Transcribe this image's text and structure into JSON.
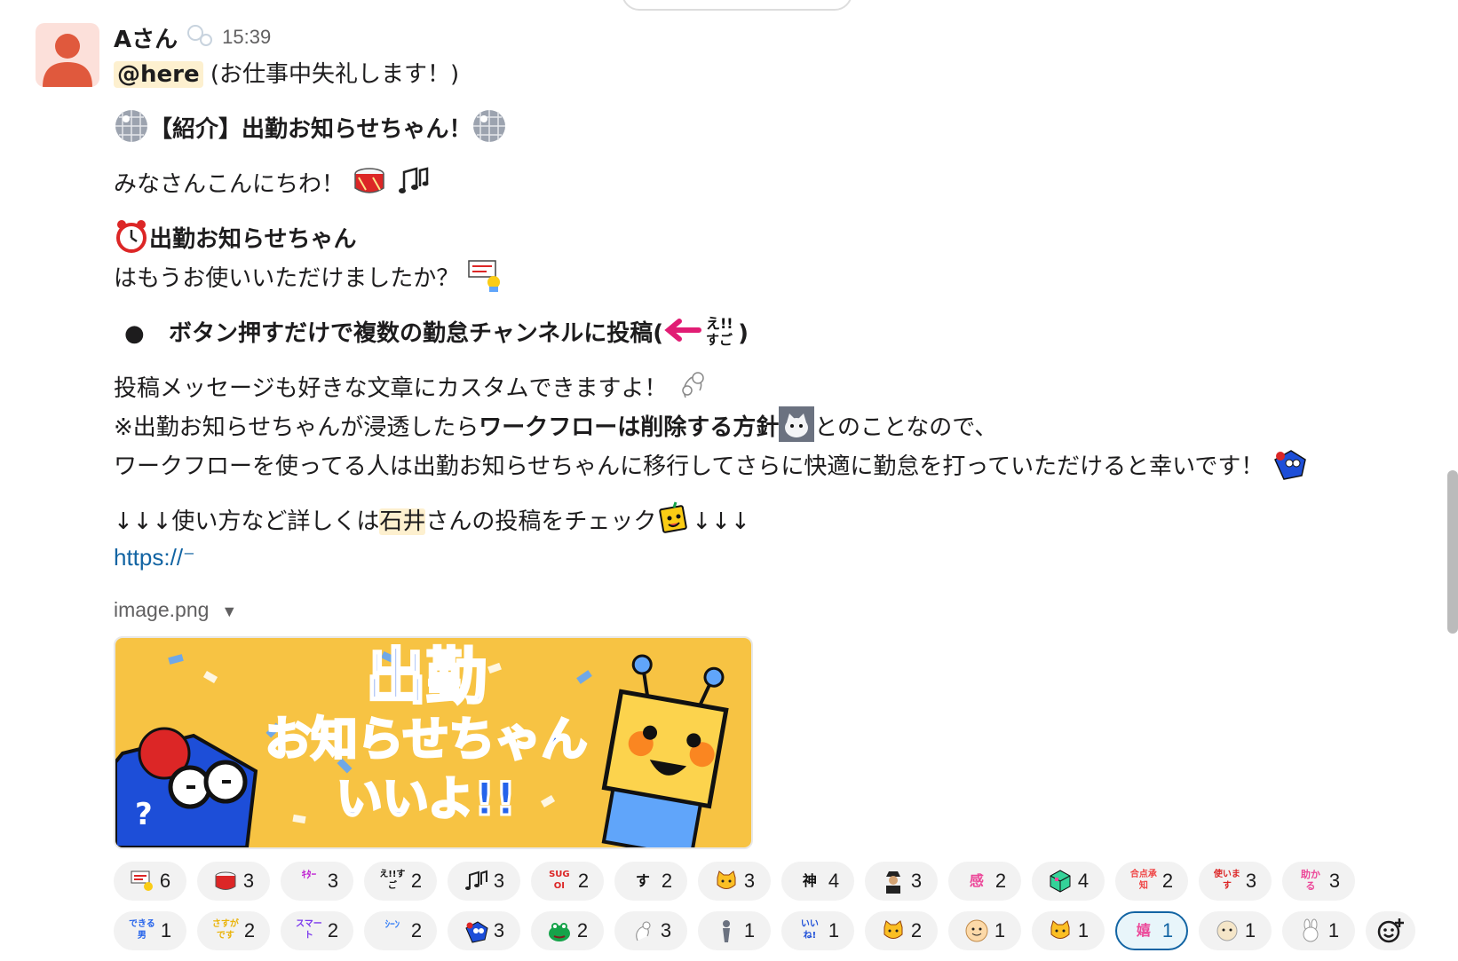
{
  "message": {
    "sender": "Aさん",
    "time": "15:39",
    "mention": "@here",
    "greeting_rest": " (お仕事中失礼します！)",
    "title": "【紹介】出勤お知らせちゃん！",
    "hello": "みなさんこんにちわ！",
    "app_name": "出勤お知らせちゃん",
    "question": "はもうお使いいただけましたか？",
    "bullet": "ボタン押すだけで複数の勤怠チャンネルに投稿(",
    "bullet_close": ")",
    "custom_line": "投稿メッセージも好きな文章にカスタムできますよ！",
    "note_pre": "※出勤お知らせちゃんが浸透したら",
    "note_bold": "ワークフローは削除する方針",
    "note_post": "とのことなので、",
    "migrate_line": "ワークフローを使ってる人は出勤お知らせちゃんに移行してさらに快適に勤怠を打っていただけると幸いです！",
    "check_pre": "↓↓↓使い方など詳しくは",
    "check_name": "石井",
    "check_post": "さんの投稿をチェック",
    "check_arrows": "↓↓↓",
    "link": "https://⁻",
    "file_name": "image.png"
  },
  "banner": {
    "line1": "出勤",
    "line2": "お知らせちゃん",
    "line3": "いいよ!!",
    "bg_color": "#f7c343",
    "text_color": "#2563eb"
  },
  "reactions": [
    {
      "icon": "check-sign-icon",
      "label": "",
      "count": "6"
    },
    {
      "icon": "drum-icon",
      "label": "",
      "count": "3"
    },
    {
      "icon": "text-emoji-icon",
      "label": "ｷﾀｰ",
      "count": "3",
      "color": "#c026d3"
    },
    {
      "icon": "text-emoji-icon",
      "label": "え!!すご",
      "count": "2",
      "color": "#111111"
    },
    {
      "icon": "music-notes-icon",
      "label": "",
      "count": "3"
    },
    {
      "icon": "text-emoji-icon",
      "label": "SUGOI",
      "count": "2",
      "color": "#dc2626"
    },
    {
      "icon": "text-emoji-icon",
      "label": "すご",
      "count": "2",
      "color": "#111111"
    },
    {
      "icon": "cat-face-icon",
      "label": "",
      "count": "3"
    },
    {
      "icon": "text-emoji-icon",
      "label": "神",
      "count": "4",
      "color": "#111111"
    },
    {
      "icon": "person-hat-icon",
      "label": "",
      "count": "3"
    },
    {
      "icon": "text-emoji-icon",
      "label": "感謝",
      "count": "2",
      "color": "#ec4899"
    },
    {
      "icon": "cube-icon",
      "label": "",
      "count": "4"
    },
    {
      "icon": "text-emoji-icon",
      "label": "合点承知",
      "count": "2",
      "color": "#ef4444"
    },
    {
      "icon": "text-emoji-icon",
      "label": "使います",
      "count": "3",
      "color": "#dc2626"
    },
    {
      "icon": "text-emoji-icon",
      "label": "助かる",
      "count": "3",
      "color": "#ec4899"
    },
    {
      "icon": "text-emoji-icon",
      "label": "できる男",
      "count": "1",
      "color": "#2563eb"
    },
    {
      "icon": "text-emoji-icon",
      "label": "さすがです",
      "count": "2",
      "color": "#eab308"
    },
    {
      "icon": "text-emoji-icon",
      "label": "スマート",
      "count": "2",
      "color": "#7c3aed"
    },
    {
      "icon": "text-emoji-icon",
      "label": "ｼｰﾝ",
      "count": "2",
      "color": "#3b82f6"
    },
    {
      "icon": "blue-box-icon",
      "label": "",
      "count": "3"
    },
    {
      "icon": "frog-icon",
      "label": "",
      "count": "2"
    },
    {
      "icon": "ghost-icon",
      "label": "",
      "count": "3"
    },
    {
      "icon": "figure-icon",
      "label": "",
      "count": "1"
    },
    {
      "icon": "text-emoji-icon",
      "label": "いいね!",
      "count": "1",
      "color": "#1d4ed8"
    },
    {
      "icon": "cat-face-icon",
      "label": "",
      "count": "2"
    },
    {
      "icon": "smile-icon",
      "label": "",
      "count": "1"
    },
    {
      "icon": "cat-face-icon",
      "label": "",
      "count": "1"
    },
    {
      "icon": "text-emoji-icon",
      "label": "嬉び",
      "count": "1",
      "color": "#ec4899",
      "active": true
    },
    {
      "icon": "face-icon",
      "label": "",
      "count": "1"
    },
    {
      "icon": "rabbit-icon",
      "label": "",
      "count": "1"
    }
  ],
  "colors": {
    "accent": "#1264a3",
    "mention_bg": "#fdf0cf",
    "avatar_bg": "#fce0da",
    "avatar_fg": "#e0593d"
  }
}
